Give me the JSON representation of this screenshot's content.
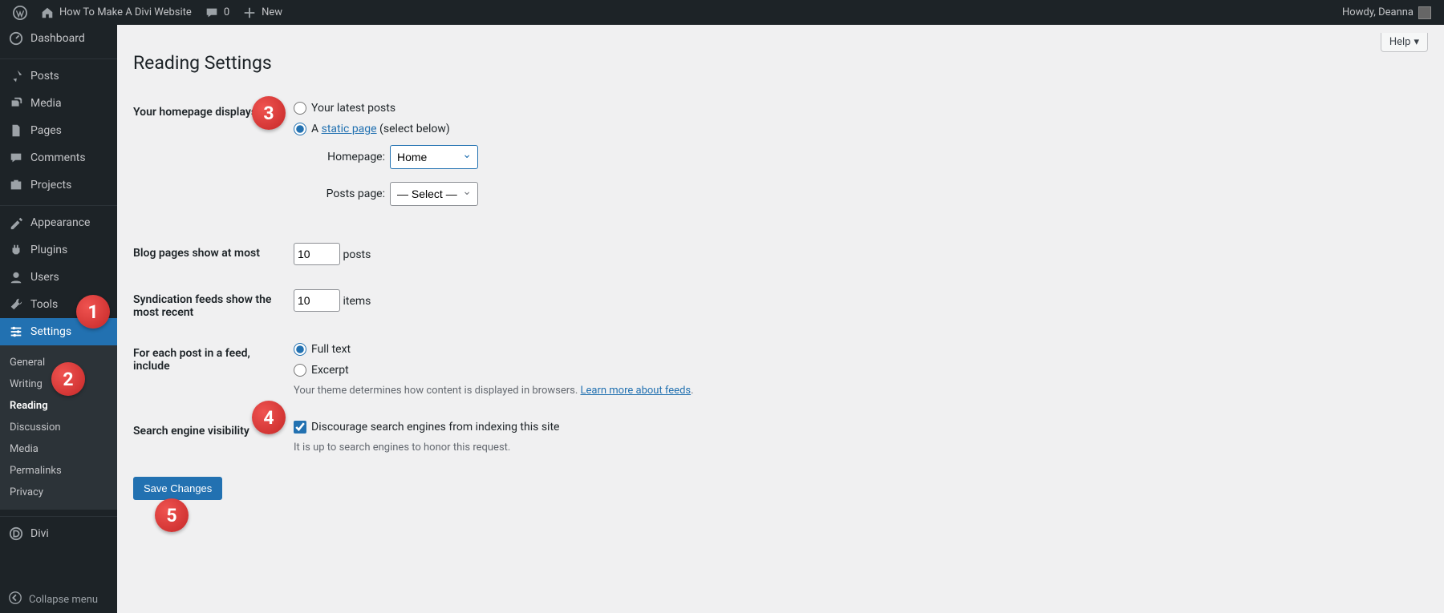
{
  "adminbar": {
    "site_title": "How To Make A Divi Website",
    "comments_count": "0",
    "new_label": "New",
    "howdy": "Howdy, Deanna"
  },
  "sidebar": {
    "items": [
      {
        "label": "Dashboard",
        "icon": "dashboard-icon"
      },
      {
        "label": "Posts",
        "icon": "pin-icon"
      },
      {
        "label": "Media",
        "icon": "media-icon"
      },
      {
        "label": "Pages",
        "icon": "page-icon"
      },
      {
        "label": "Comments",
        "icon": "comment-icon"
      },
      {
        "label": "Projects",
        "icon": "projects-icon"
      },
      {
        "label": "Appearance",
        "icon": "appearance-icon"
      },
      {
        "label": "Plugins",
        "icon": "plugin-icon"
      },
      {
        "label": "Users",
        "icon": "user-icon"
      },
      {
        "label": "Tools",
        "icon": "tools-icon"
      },
      {
        "label": "Settings",
        "icon": "settings-icon"
      },
      {
        "label": "Divi",
        "icon": "divi-icon"
      }
    ],
    "settings_submenu": [
      "General",
      "Writing",
      "Reading",
      "Discussion",
      "Media",
      "Permalinks",
      "Privacy"
    ],
    "collapse_label": "Collapse menu"
  },
  "content": {
    "help_label": "Help",
    "page_title": "Reading Settings",
    "homepage_displays": {
      "label": "Your homepage displays",
      "opt_latest": "Your latest posts",
      "opt_static_prefix": "A ",
      "opt_static_link": "static page",
      "opt_static_suffix": " (select below)",
      "homepage_label": "Homepage:",
      "homepage_value": "Home",
      "postspage_label": "Posts page:",
      "postspage_value": "— Select —"
    },
    "blog_pages": {
      "label": "Blog pages show at most",
      "value": "10",
      "suffix": "posts"
    },
    "syndication": {
      "label": "Syndication feeds show the most recent",
      "value": "10",
      "suffix": "items"
    },
    "feed_include": {
      "label": "For each post in a feed, include",
      "opt_full": "Full text",
      "opt_excerpt": "Excerpt",
      "desc_prefix": "Your theme determines how content is displayed in browsers. ",
      "desc_link": "Learn more about feeds",
      "desc_suffix": "."
    },
    "search_vis": {
      "label": "Search engine visibility",
      "checkbox": "Discourage search engines from indexing this site",
      "desc": "It is up to search engines to honor this request."
    },
    "save_label": "Save Changes"
  },
  "annotations": {
    "b1": "1",
    "b2": "2",
    "b3": "3",
    "b4": "4",
    "b5": "5"
  }
}
